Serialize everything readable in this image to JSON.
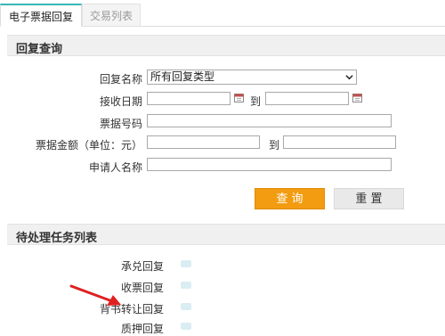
{
  "tabs": [
    {
      "label": "电子票据回复",
      "active": true
    },
    {
      "label": "交易列表",
      "active": false
    }
  ],
  "query_section": {
    "title": "回复查询"
  },
  "form": {
    "reply_name_label": "回复名称",
    "reply_name_value": "所有回复类型",
    "receive_date_label": "接收日期",
    "to_label": "到",
    "bill_number_label": "票据号码",
    "amount_label": "票据金额（单位：元）",
    "amount_to_label": "到",
    "applicant_label": "申请人名称"
  },
  "buttons": {
    "query": "查 询",
    "reset": "重 置"
  },
  "task_section": {
    "title": "待处理任务列表",
    "items": [
      {
        "label": "承兑回复"
      },
      {
        "label": "收票回复"
      },
      {
        "label": "背书转让回复"
      },
      {
        "label": "质押回复"
      }
    ]
  },
  "colors": {
    "accent": "#35b6b5",
    "query_button": "#f39c12",
    "annotation_arrow": "#e02020"
  }
}
